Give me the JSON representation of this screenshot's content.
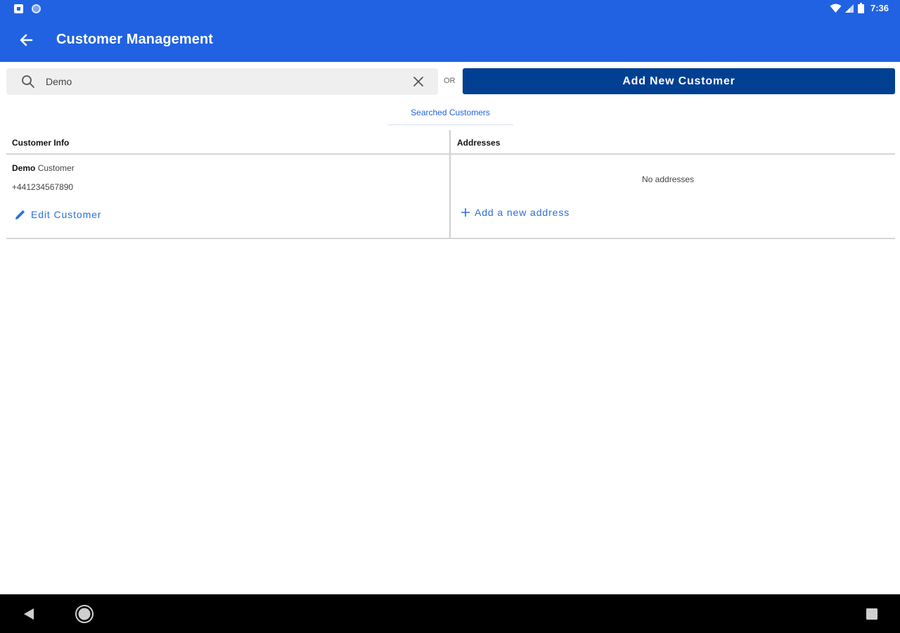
{
  "status_bar": {
    "time": "7:36",
    "icons": [
      "notification-square-icon",
      "notification-circle-icon",
      "wifi-icon",
      "signal-icon",
      "battery-icon"
    ]
  },
  "app_bar": {
    "title": "Customer Management",
    "back_icon": "arrow-left-icon",
    "background": "#2162e2"
  },
  "search": {
    "value": "Demo",
    "placeholder": "",
    "search_icon": "magnifier-icon",
    "clear_icon": "close-icon"
  },
  "or_label": "OR",
  "add_customer_button": {
    "label": "Add New Customer",
    "background": "#003f92"
  },
  "tabs": [
    {
      "label": "Searched Customers",
      "active": true
    }
  ],
  "table": {
    "headers": {
      "customer_info": "Customer Info",
      "addresses": "Addresses"
    },
    "rows": [
      {
        "first_name": "Demo",
        "last_name": "Customer",
        "phone": "+441234567890",
        "edit_label": "Edit Customer",
        "addresses_empty": "No addresses",
        "add_address_label": "Add a new address"
      }
    ]
  },
  "nav_bar": {
    "icons": [
      "back-triangle-icon",
      "home-circle-icon",
      "recents-square-icon"
    ]
  },
  "colors": {
    "primary": "#2162e2",
    "button_dark": "#003f92",
    "link": "#2a6fe0"
  }
}
